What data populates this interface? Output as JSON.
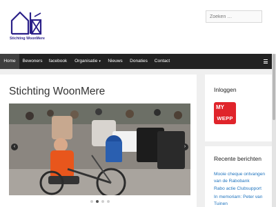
{
  "site": {
    "logo_text": "Stichting WoonMere"
  },
  "search": {
    "placeholder": "Zoeken …"
  },
  "nav": {
    "items": [
      {
        "label": "Home",
        "active": true
      },
      {
        "label": "Bewoners"
      },
      {
        "label": "facebook"
      },
      {
        "label": "Organisatie",
        "has_dropdown": true
      },
      {
        "label": "Nieuws"
      },
      {
        "label": "Donaties"
      },
      {
        "label": "Contact"
      }
    ]
  },
  "main": {
    "title": "Stichting WoonMere",
    "slider": {
      "slide_count": 4,
      "active_index": 1
    }
  },
  "sidebar": {
    "login_title": "Inloggen",
    "app_badge": {
      "prefix": "MY",
      "label": "WEPP"
    },
    "recent_title": "Recente berichten",
    "recent_posts": [
      "Mooie cheque ontvangen van de Rabobank",
      "Rabo actie Clubsupport",
      "In memoriam: Peter van Tuinen"
    ]
  },
  "colors": {
    "brand": "#2a1f88",
    "nav_bg": "#222222",
    "nav_active": "#3f3f3f",
    "link": "#1e73be",
    "badge_red": "#e0242b"
  }
}
